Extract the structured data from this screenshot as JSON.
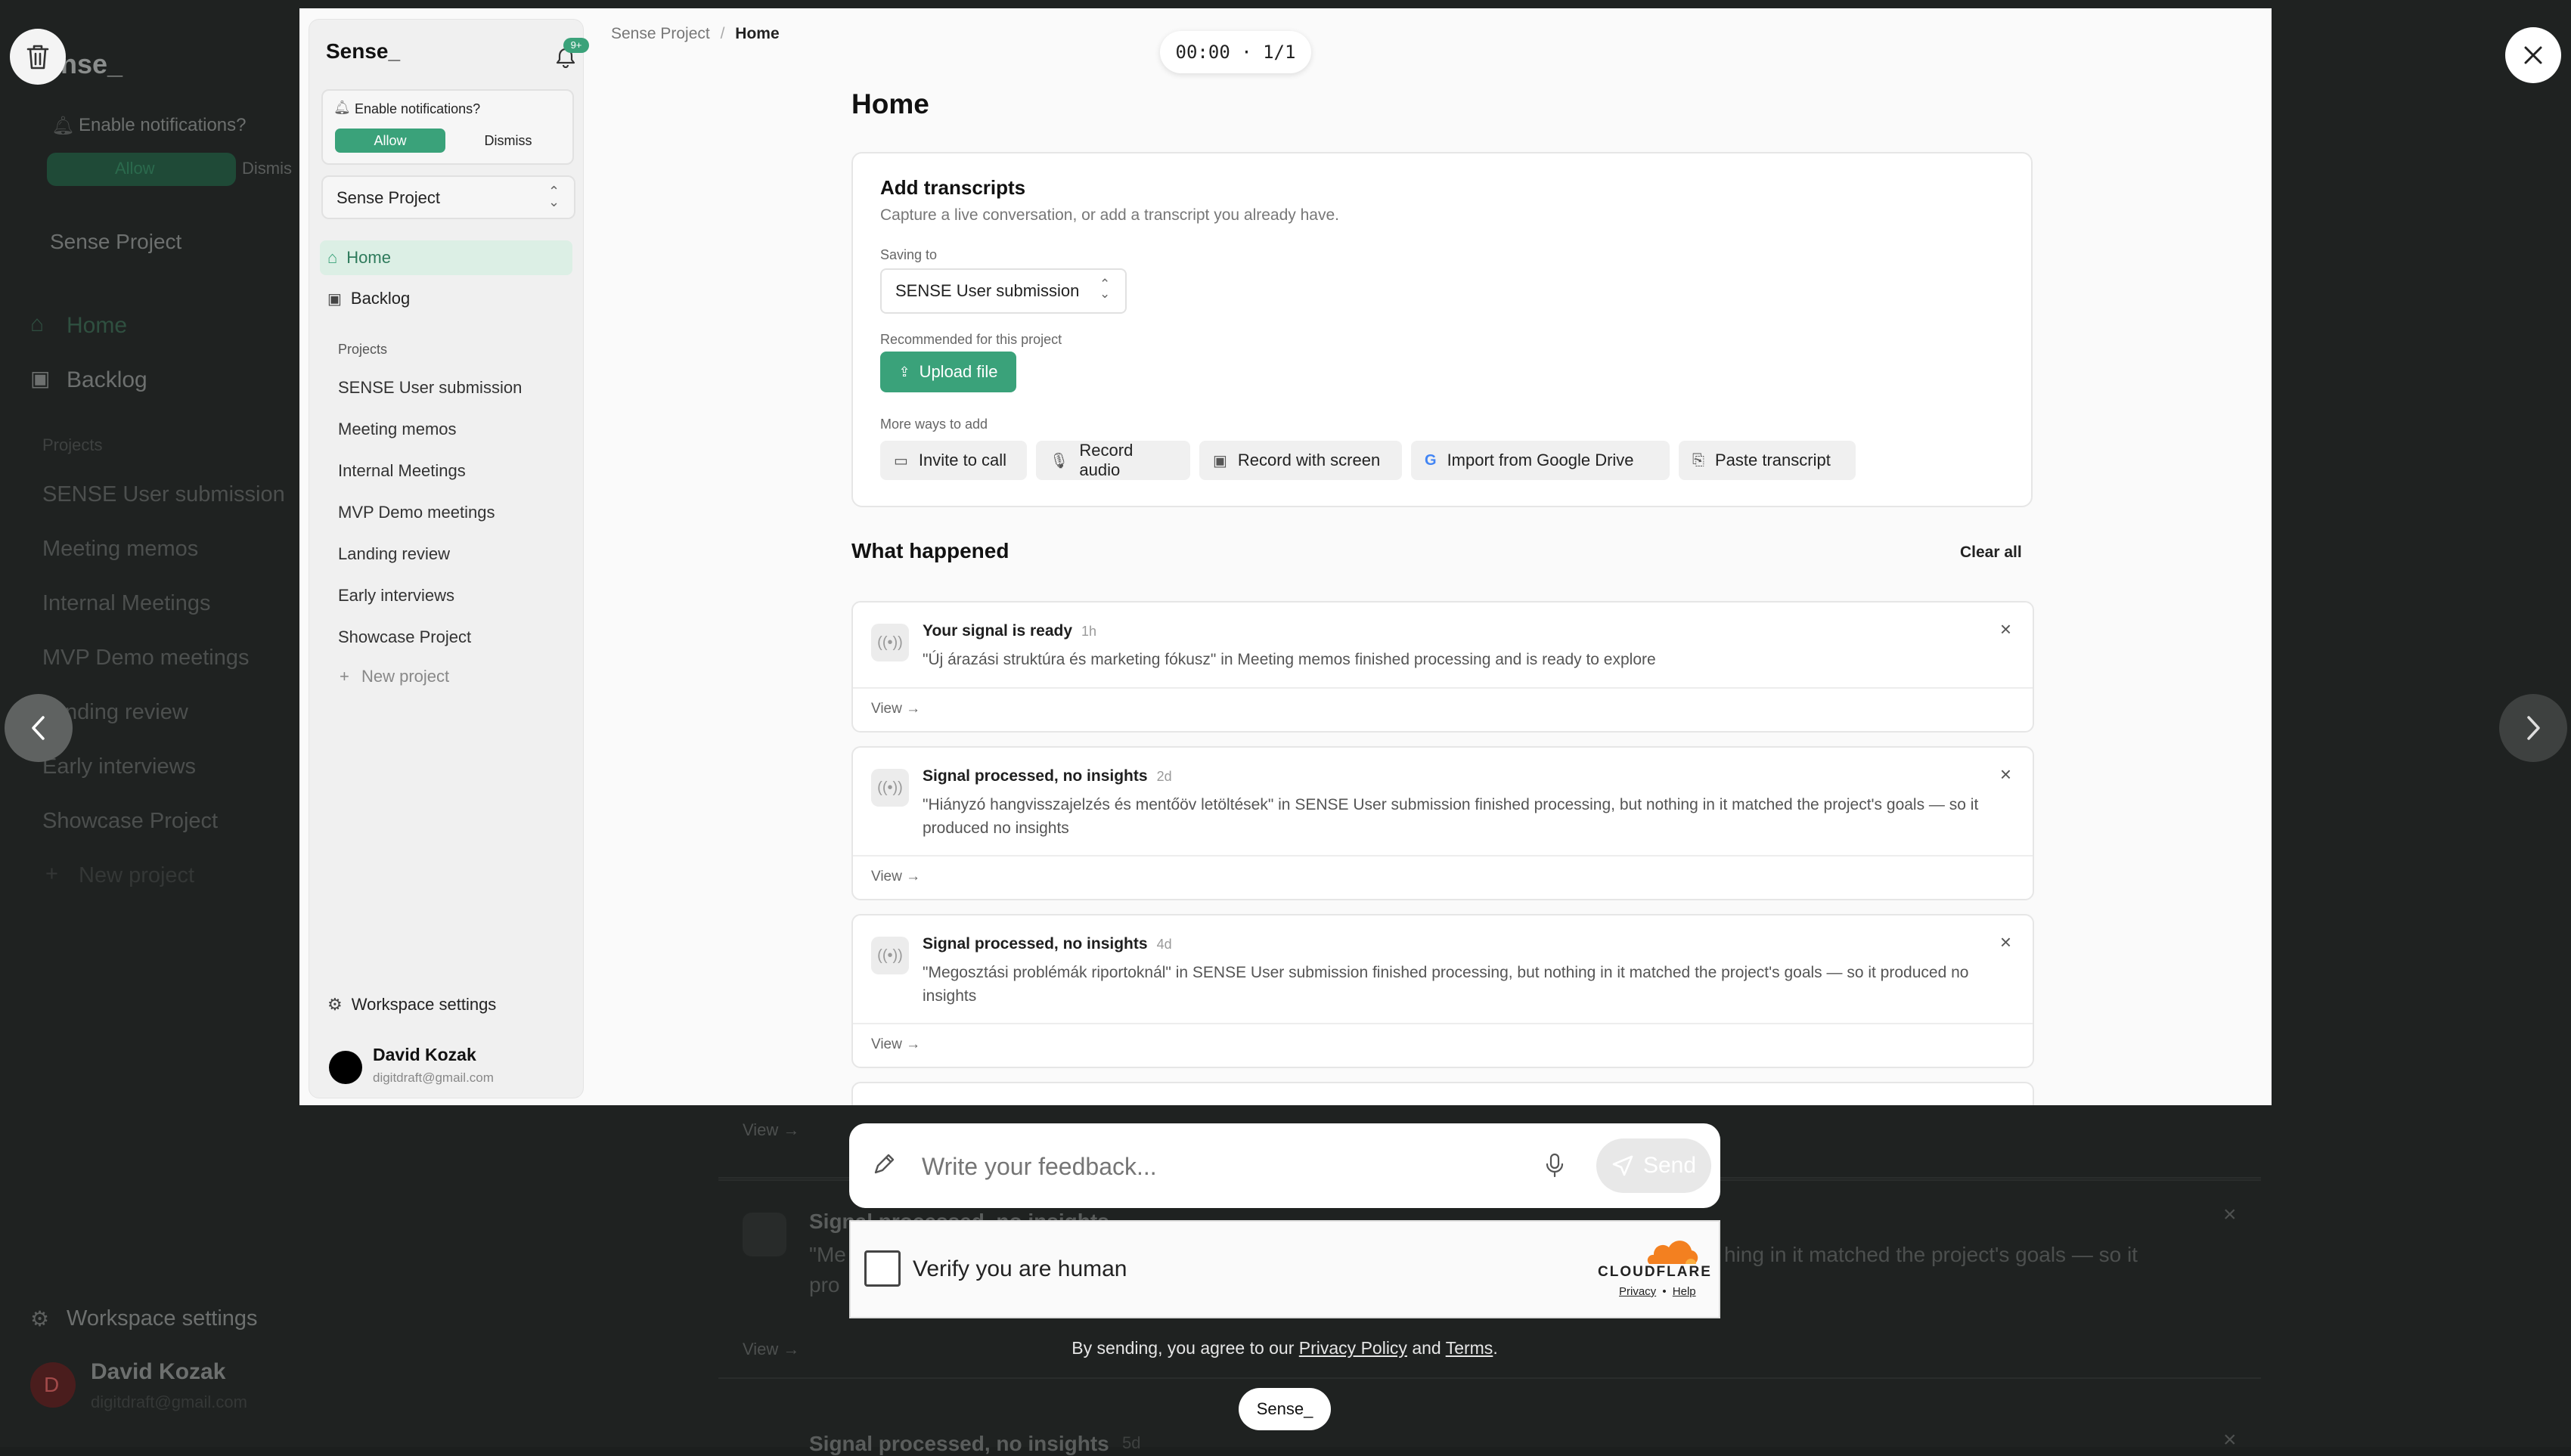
{
  "background": {
    "brand": "ense_",
    "enable_notifications": "Enable notifications?",
    "allow": "Allow",
    "dismiss": "Dismis",
    "project": "Sense Project",
    "home": "Home",
    "backlog": "Backlog",
    "projects_heading": "Projects",
    "projects": [
      "SENSE User submission",
      "Meeting memos",
      "Internal Meetings",
      "MVP Demo meetings",
      "nding review",
      "Early interviews",
      "Showcase Project"
    ],
    "new_project": "New project",
    "workspace_settings": "Workspace settings",
    "user_initial": "D",
    "user_name": "David Kozak",
    "user_email": "digitdraft@gmail.com",
    "view1": "View →",
    "sig_title": "Signal processed, no insights",
    "sig_desc1": "\"Me",
    "sig_desc_tail": "hing in it matched the project's goals — so it",
    "sig_desc2": "pro",
    "view2": "View →",
    "sig_title2": "Signal processed, no insights",
    "sig_age2": "5d"
  },
  "recorder": {
    "timer": "00:00 · 1/1",
    "trash_label": "delete",
    "close_label": "close"
  },
  "app": {
    "brand": "Sense_",
    "badge": "9+",
    "notif_prompt": "Enable notifications?",
    "allow": "Allow",
    "dismiss": "Dismiss",
    "project_selector": "Sense Project",
    "nav_home": "Home",
    "nav_backlog": "Backlog",
    "projects_heading": "Projects",
    "projects": [
      "SENSE User submission",
      "Meeting memos",
      "Internal Meetings",
      "MVP Demo meetings",
      "Landing review",
      "Early interviews",
      "Showcase Project"
    ],
    "new_project": "New project",
    "workspace_settings": "Workspace settings",
    "user_name": "David Kozak",
    "user_email": "digitdraft@gmail.com",
    "breadcrumb_root": "Sense Project",
    "breadcrumb_sep": "/",
    "breadcrumb_current": "Home",
    "page_title": "Home",
    "add": {
      "title": "Add transcripts",
      "subtitle": "Capture a live conversation, or add a transcript you already have.",
      "saving_to_label": "Saving to",
      "saving_to_value": "SENSE User submission",
      "recommended_label": "Recommended for this project",
      "upload": "Upload file",
      "more_label": "More ways to add",
      "buttons": [
        "Invite to call",
        "Record audio",
        "Record with screen",
        "Import from Google Drive",
        "Paste transcript"
      ]
    },
    "what_happened": "What happened",
    "clear_all": "Clear all",
    "signals": [
      {
        "title": "Your signal is ready",
        "age": "1h",
        "desc": "\"Új árazási struktúra és marketing fókusz\" in Meeting memos finished processing and is ready to explore",
        "view": "View →"
      },
      {
        "title": "Signal processed, no insights",
        "age": "2d",
        "desc": "\"Hiányzó hangvisszajelzés és mentőöv letöltések\" in SENSE User submission finished processing, but nothing in it matched the project's goals — so it produced no insights",
        "view": "View →"
      },
      {
        "title": "Signal processed, no insights",
        "age": "4d",
        "desc": "\"Megosztási problémák riportoknál\" in SENSE User submission finished processing, but nothing in it matched the project's goals — so it produced no insights",
        "view": "View →"
      }
    ]
  },
  "feedback": {
    "placeholder": "Write your feedback...",
    "send": "Send",
    "verify": "Verify you are human",
    "cf_brand": "CLOUDFLARE",
    "cf_privacy": "Privacy",
    "cf_dot": "•",
    "cf_help": "Help",
    "terms_prefix": "By sending, you agree to our",
    "privacy_policy": "Privacy Policy",
    "and": "and",
    "terms": "Terms",
    "period": ".",
    "brand_pill": "Sense_"
  },
  "colors": {
    "accent": "#3aa27a",
    "accent_light": "#e3f1ea",
    "cloudflare": "#f38020"
  }
}
